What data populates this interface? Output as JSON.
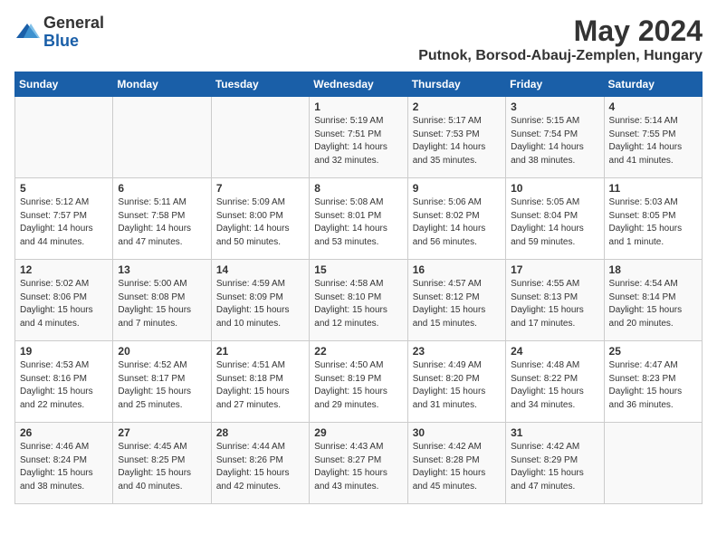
{
  "header": {
    "logo_general": "General",
    "logo_blue": "Blue",
    "month_title": "May 2024",
    "location": "Putnok, Borsod-Abauj-Zemplen, Hungary"
  },
  "days_of_week": [
    "Sunday",
    "Monday",
    "Tuesday",
    "Wednesday",
    "Thursday",
    "Friday",
    "Saturday"
  ],
  "weeks": [
    [
      {
        "day": "",
        "info": ""
      },
      {
        "day": "",
        "info": ""
      },
      {
        "day": "",
        "info": ""
      },
      {
        "day": "1",
        "info": "Sunrise: 5:19 AM\nSunset: 7:51 PM\nDaylight: 14 hours\nand 32 minutes."
      },
      {
        "day": "2",
        "info": "Sunrise: 5:17 AM\nSunset: 7:53 PM\nDaylight: 14 hours\nand 35 minutes."
      },
      {
        "day": "3",
        "info": "Sunrise: 5:15 AM\nSunset: 7:54 PM\nDaylight: 14 hours\nand 38 minutes."
      },
      {
        "day": "4",
        "info": "Sunrise: 5:14 AM\nSunset: 7:55 PM\nDaylight: 14 hours\nand 41 minutes."
      }
    ],
    [
      {
        "day": "5",
        "info": "Sunrise: 5:12 AM\nSunset: 7:57 PM\nDaylight: 14 hours\nand 44 minutes."
      },
      {
        "day": "6",
        "info": "Sunrise: 5:11 AM\nSunset: 7:58 PM\nDaylight: 14 hours\nand 47 minutes."
      },
      {
        "day": "7",
        "info": "Sunrise: 5:09 AM\nSunset: 8:00 PM\nDaylight: 14 hours\nand 50 minutes."
      },
      {
        "day": "8",
        "info": "Sunrise: 5:08 AM\nSunset: 8:01 PM\nDaylight: 14 hours\nand 53 minutes."
      },
      {
        "day": "9",
        "info": "Sunrise: 5:06 AM\nSunset: 8:02 PM\nDaylight: 14 hours\nand 56 minutes."
      },
      {
        "day": "10",
        "info": "Sunrise: 5:05 AM\nSunset: 8:04 PM\nDaylight: 14 hours\nand 59 minutes."
      },
      {
        "day": "11",
        "info": "Sunrise: 5:03 AM\nSunset: 8:05 PM\nDaylight: 15 hours\nand 1 minute."
      }
    ],
    [
      {
        "day": "12",
        "info": "Sunrise: 5:02 AM\nSunset: 8:06 PM\nDaylight: 15 hours\nand 4 minutes."
      },
      {
        "day": "13",
        "info": "Sunrise: 5:00 AM\nSunset: 8:08 PM\nDaylight: 15 hours\nand 7 minutes."
      },
      {
        "day": "14",
        "info": "Sunrise: 4:59 AM\nSunset: 8:09 PM\nDaylight: 15 hours\nand 10 minutes."
      },
      {
        "day": "15",
        "info": "Sunrise: 4:58 AM\nSunset: 8:10 PM\nDaylight: 15 hours\nand 12 minutes."
      },
      {
        "day": "16",
        "info": "Sunrise: 4:57 AM\nSunset: 8:12 PM\nDaylight: 15 hours\nand 15 minutes."
      },
      {
        "day": "17",
        "info": "Sunrise: 4:55 AM\nSunset: 8:13 PM\nDaylight: 15 hours\nand 17 minutes."
      },
      {
        "day": "18",
        "info": "Sunrise: 4:54 AM\nSunset: 8:14 PM\nDaylight: 15 hours\nand 20 minutes."
      }
    ],
    [
      {
        "day": "19",
        "info": "Sunrise: 4:53 AM\nSunset: 8:16 PM\nDaylight: 15 hours\nand 22 minutes."
      },
      {
        "day": "20",
        "info": "Sunrise: 4:52 AM\nSunset: 8:17 PM\nDaylight: 15 hours\nand 25 minutes."
      },
      {
        "day": "21",
        "info": "Sunrise: 4:51 AM\nSunset: 8:18 PM\nDaylight: 15 hours\nand 27 minutes."
      },
      {
        "day": "22",
        "info": "Sunrise: 4:50 AM\nSunset: 8:19 PM\nDaylight: 15 hours\nand 29 minutes."
      },
      {
        "day": "23",
        "info": "Sunrise: 4:49 AM\nSunset: 8:20 PM\nDaylight: 15 hours\nand 31 minutes."
      },
      {
        "day": "24",
        "info": "Sunrise: 4:48 AM\nSunset: 8:22 PM\nDaylight: 15 hours\nand 34 minutes."
      },
      {
        "day": "25",
        "info": "Sunrise: 4:47 AM\nSunset: 8:23 PM\nDaylight: 15 hours\nand 36 minutes."
      }
    ],
    [
      {
        "day": "26",
        "info": "Sunrise: 4:46 AM\nSunset: 8:24 PM\nDaylight: 15 hours\nand 38 minutes."
      },
      {
        "day": "27",
        "info": "Sunrise: 4:45 AM\nSunset: 8:25 PM\nDaylight: 15 hours\nand 40 minutes."
      },
      {
        "day": "28",
        "info": "Sunrise: 4:44 AM\nSunset: 8:26 PM\nDaylight: 15 hours\nand 42 minutes."
      },
      {
        "day": "29",
        "info": "Sunrise: 4:43 AM\nSunset: 8:27 PM\nDaylight: 15 hours\nand 43 minutes."
      },
      {
        "day": "30",
        "info": "Sunrise: 4:42 AM\nSunset: 8:28 PM\nDaylight: 15 hours\nand 45 minutes."
      },
      {
        "day": "31",
        "info": "Sunrise: 4:42 AM\nSunset: 8:29 PM\nDaylight: 15 hours\nand 47 minutes."
      },
      {
        "day": "",
        "info": ""
      }
    ]
  ]
}
